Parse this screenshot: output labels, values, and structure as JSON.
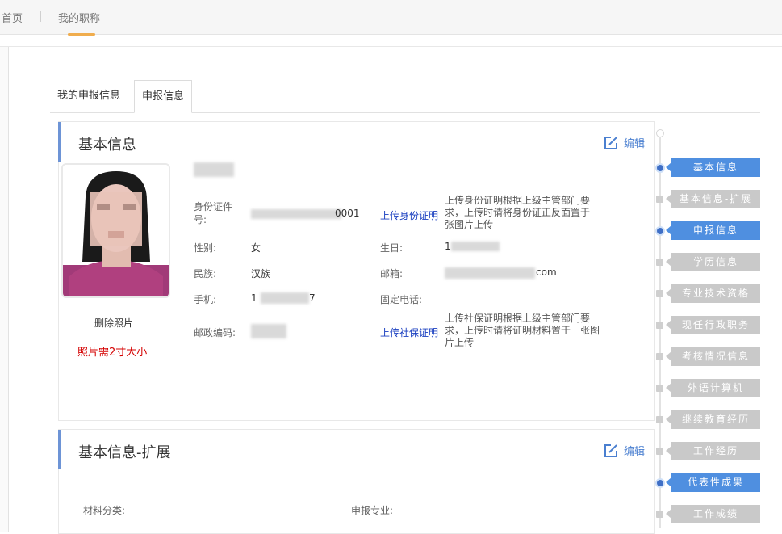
{
  "topnav": {
    "home": "首页",
    "my_title": "我的职称"
  },
  "tabs": [
    {
      "label": "我的申报信息"
    },
    {
      "label": "申报信息"
    }
  ],
  "edit_label": "编辑",
  "basic": {
    "title": "基本信息",
    "delete_photo": "删除照片",
    "photo_note": "照片需2寸大小",
    "fields": {
      "id_label": "身份证件号:",
      "id_value_tail": "0001",
      "gender_label": "性别:",
      "gender_value": "女",
      "ethnicity_label": "民族:",
      "ethnicity_value": "汉族",
      "mobile_label": "手机:",
      "mobile_value_head": "1",
      "mobile_value_tail": "7",
      "postal_label": "邮政编码:",
      "birthday_label": "生日:",
      "birthday_value_head": "1",
      "email_label": "邮箱:",
      "email_value_tail": "com",
      "phone_label": "固定电话:"
    },
    "upload_id_link": "上传身份证明",
    "upload_id_tip": "上传身份证明根据上级主管部门要求，上传时请将身份证正反面置于一张图片上传",
    "upload_social_link": "上传社保证明",
    "upload_social_tip": "上传社保证明根据上级主管部门要求，上传时请将证明材料置于一张图片上传"
  },
  "ext": {
    "title": "基本信息-扩展",
    "material_label": "材料分类:",
    "major_label": "申报专业:"
  },
  "steps": [
    {
      "label": "基本信息",
      "active": true
    },
    {
      "label": "基本信息-扩展",
      "active": false
    },
    {
      "label": "申报信息",
      "active": true
    },
    {
      "label": "学历信息",
      "active": false
    },
    {
      "label": "专业技术资格",
      "active": false
    },
    {
      "label": "现任行政职务",
      "active": false
    },
    {
      "label": "考核情况信息",
      "active": false
    },
    {
      "label": "外语计算机",
      "active": false
    },
    {
      "label": "继续教育经历",
      "active": false
    },
    {
      "label": "工作经历",
      "active": false
    },
    {
      "label": "代表性成果",
      "active": true
    },
    {
      "label": "工作成绩",
      "active": false
    }
  ]
}
